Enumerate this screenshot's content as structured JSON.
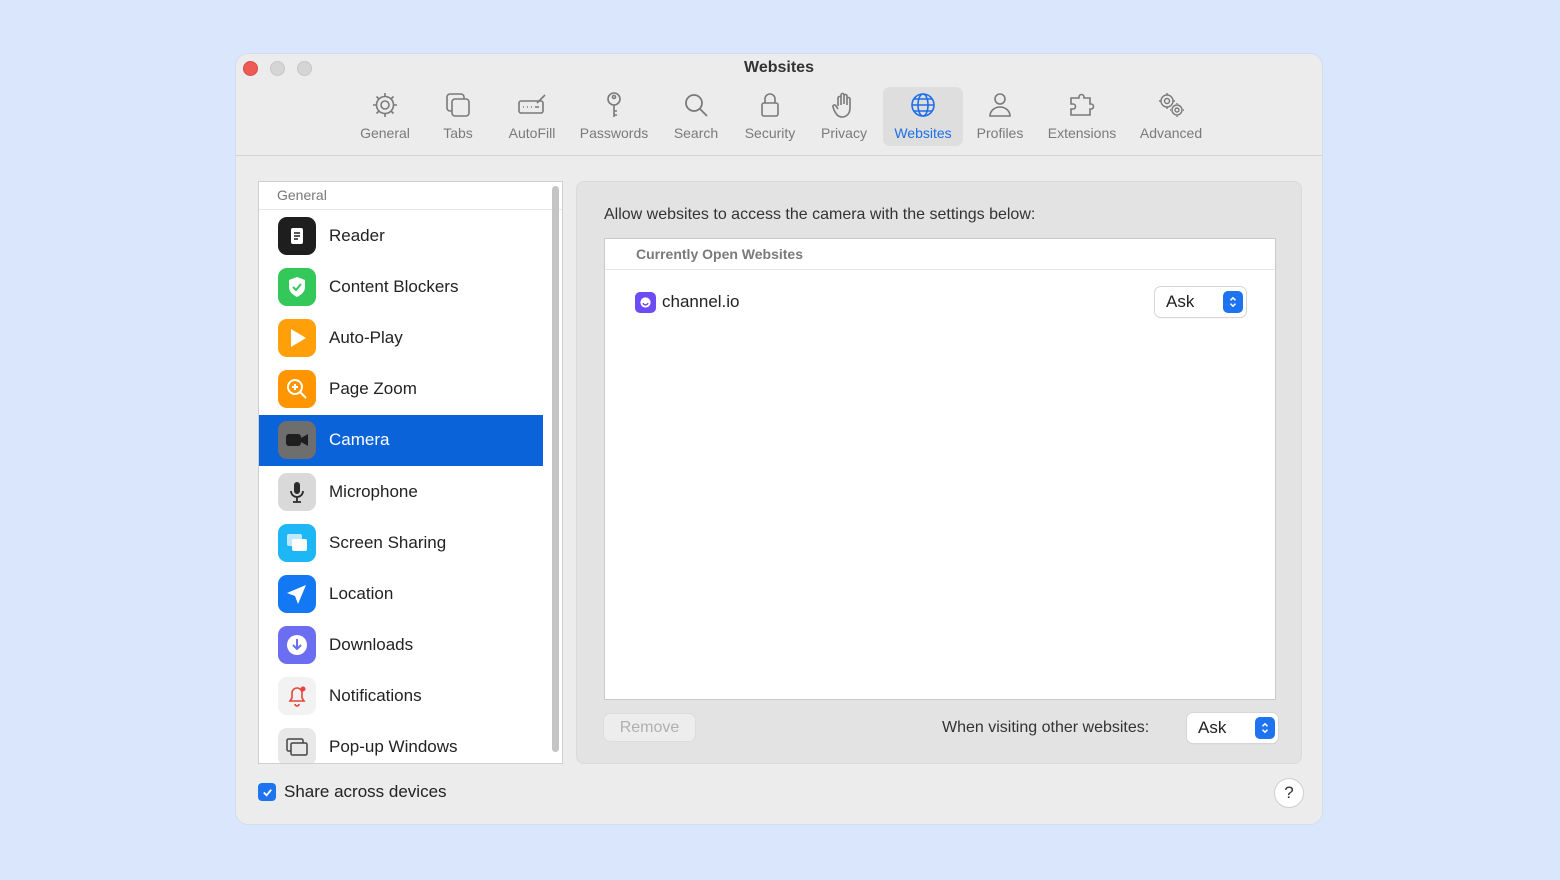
{
  "window": {
    "title": "Websites"
  },
  "toolbar": {
    "items": [
      {
        "label": "General",
        "icon": "gear-icon"
      },
      {
        "label": "Tabs",
        "icon": "tabs-icon"
      },
      {
        "label": "AutoFill",
        "icon": "autofill-icon"
      },
      {
        "label": "Passwords",
        "icon": "key-icon"
      },
      {
        "label": "Search",
        "icon": "search-icon"
      },
      {
        "label": "Security",
        "icon": "lock-icon"
      },
      {
        "label": "Privacy",
        "icon": "hand-icon"
      },
      {
        "label": "Websites",
        "icon": "globe-icon",
        "active": true
      },
      {
        "label": "Profiles",
        "icon": "person-icon"
      },
      {
        "label": "Extensions",
        "icon": "puzzle-icon"
      },
      {
        "label": "Advanced",
        "icon": "gears-icon"
      }
    ]
  },
  "sidebar": {
    "header": "General",
    "items": [
      {
        "label": "Reader",
        "icon": "reader-icon",
        "color": "#1e1e1e"
      },
      {
        "label": "Content Blockers",
        "icon": "shield-check-icon",
        "color": "#34c759"
      },
      {
        "label": "Auto-Play",
        "icon": "play-icon",
        "color": "#ff9f0a"
      },
      {
        "label": "Page Zoom",
        "icon": "zoom-icon",
        "color": "#ff9500"
      },
      {
        "label": "Camera",
        "icon": "camera-icon",
        "color": "#6e6e6e",
        "selected": true
      },
      {
        "label": "Microphone",
        "icon": "microphone-icon",
        "color": "#d9d9d9"
      },
      {
        "label": "Screen Sharing",
        "icon": "screen-sharing-icon",
        "color": "#1eb7f5"
      },
      {
        "label": "Location",
        "icon": "location-arrow-icon",
        "color": "#1278f3"
      },
      {
        "label": "Downloads",
        "icon": "download-icon",
        "color": "#6b6ef0"
      },
      {
        "label": "Notifications",
        "icon": "bell-icon",
        "color": "#f2f2f2"
      },
      {
        "label": "Pop-up Windows",
        "icon": "popup-windows-icon",
        "color": "#e8e8e8"
      }
    ]
  },
  "panel": {
    "description": "Allow websites to access the camera with the settings below:",
    "list_header": "Currently Open Websites",
    "sites": [
      {
        "name": "channel.io",
        "setting": "Ask"
      }
    ],
    "remove_label": "Remove",
    "other_label": "When visiting other websites:",
    "other_value": "Ask"
  },
  "footer": {
    "share_label": "Share across devices",
    "share_checked": true,
    "help_label": "?"
  },
  "colors": {
    "accent": "#1d73f0",
    "selection": "#0a63d8",
    "background": "#d9e6fb"
  }
}
